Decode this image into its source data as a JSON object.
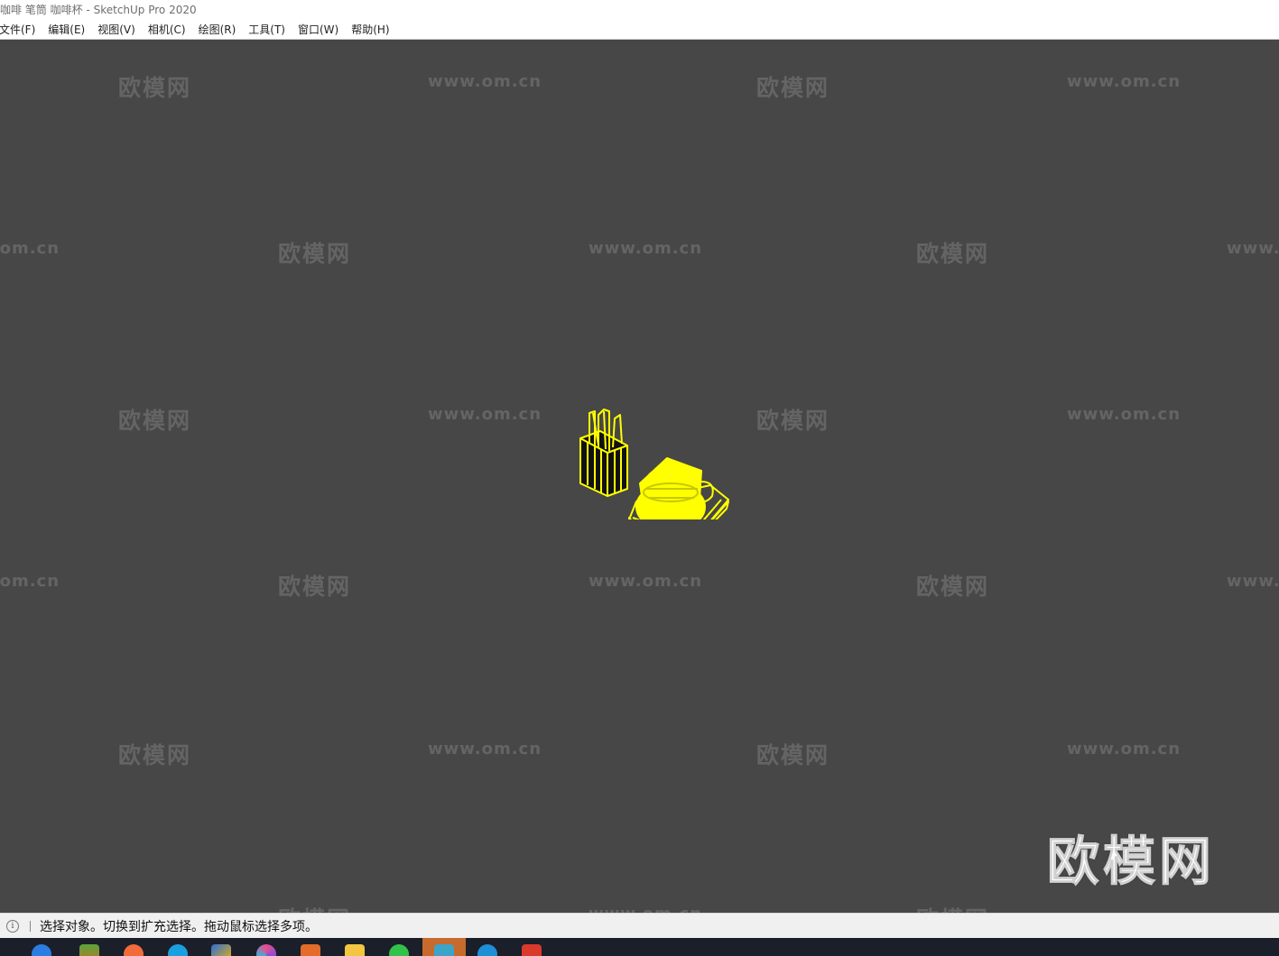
{
  "window": {
    "title": "咖啡 笔筒 咖啡杯 - SketchUp Pro 2020"
  },
  "menu": {
    "items": [
      "文件(F)",
      "编辑(E)",
      "视图(V)",
      "相机(C)",
      "绘图(R)",
      "工具(T)",
      "窗口(W)",
      "帮助(H)"
    ]
  },
  "watermark": {
    "logo": "欧模网",
    "url": "www.om.cn"
  },
  "statusbar": {
    "message": "选择对象。切换到扩充选择。拖动鼠标选择多项。",
    "info_icon": "info-icon"
  },
  "model": {
    "description_color": "#ffff00",
    "objects": [
      "pen-holder",
      "coffee-cup",
      "saucer-tray"
    ]
  },
  "taskbar": {
    "icons": [
      "edge-icon",
      "photo-icon",
      "media-player-icon",
      "browser-icon",
      "video-icon",
      "paint-icon",
      "tool-icon",
      "folder-icon",
      "wechat-icon",
      "sketchup-icon",
      "edge-new-icon",
      "sketchup-red-icon"
    ]
  },
  "colors": {
    "viewport_bg": "#474747",
    "selection": "#ffff00",
    "taskbar_bg": "#1b1f2a",
    "active_task": "#c66b2d"
  }
}
